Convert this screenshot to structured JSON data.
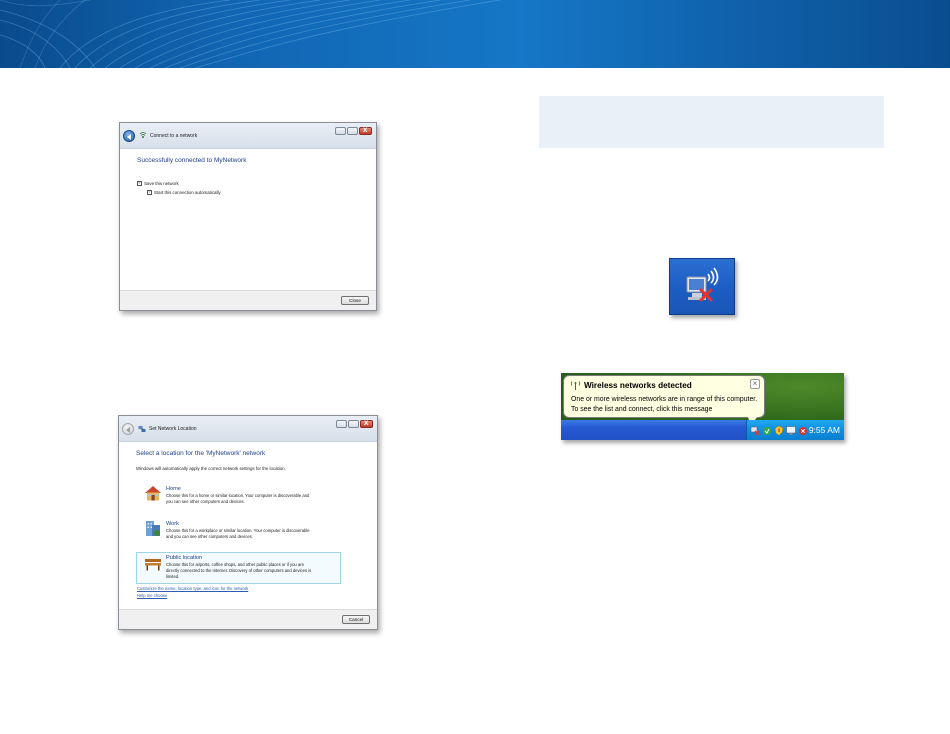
{
  "dialog_connected": {
    "title": "Connect to a network",
    "heading": "Successfully connected to MyNetwork",
    "checkbox_save": "Save this network",
    "checkbox_auto": "Start this connection automatically",
    "close_button": "Close"
  },
  "dialog_location": {
    "title": "Set Network Location",
    "heading": "Select a location for the 'MyNetwork' network",
    "intro": "Windows will automatically apply the correct network settings for the location.",
    "options": [
      {
        "title": "Home",
        "desc_line1": "Choose this for a home or similar location. Your computer is discoverable and",
        "desc_line2": "you can see other computers and devices.",
        "desc_line3": ""
      },
      {
        "title": "Work",
        "desc_line1": "Choose this for a workplace or similar location. Your computer is discoverable",
        "desc_line2": "and you can see other computers and devices.",
        "desc_line3": ""
      },
      {
        "title": "Public location",
        "desc_line1": "Choose this for airports, coffee shops, and other public places or if you are",
        "desc_line2": "directly connected to the Internet. Discovery of other computers and devices is",
        "desc_line3": "limited."
      }
    ],
    "link_customize": "Customize the name, location type, and icon for the network",
    "link_help": "Help me choose",
    "cancel_button": "Cancel"
  },
  "balloon": {
    "title": "Wireless networks detected",
    "line1": "One or more wireless networks are in range of this computer.",
    "line2": "To see the list and connect, click this message"
  },
  "taskbar": {
    "clock": "9:55 AM"
  },
  "colors": {
    "banner": "#1166b3",
    "info_box": "#eaf0f8",
    "heading_blue": "#1e3f8a",
    "xp_taskbar": "#2558d2"
  }
}
